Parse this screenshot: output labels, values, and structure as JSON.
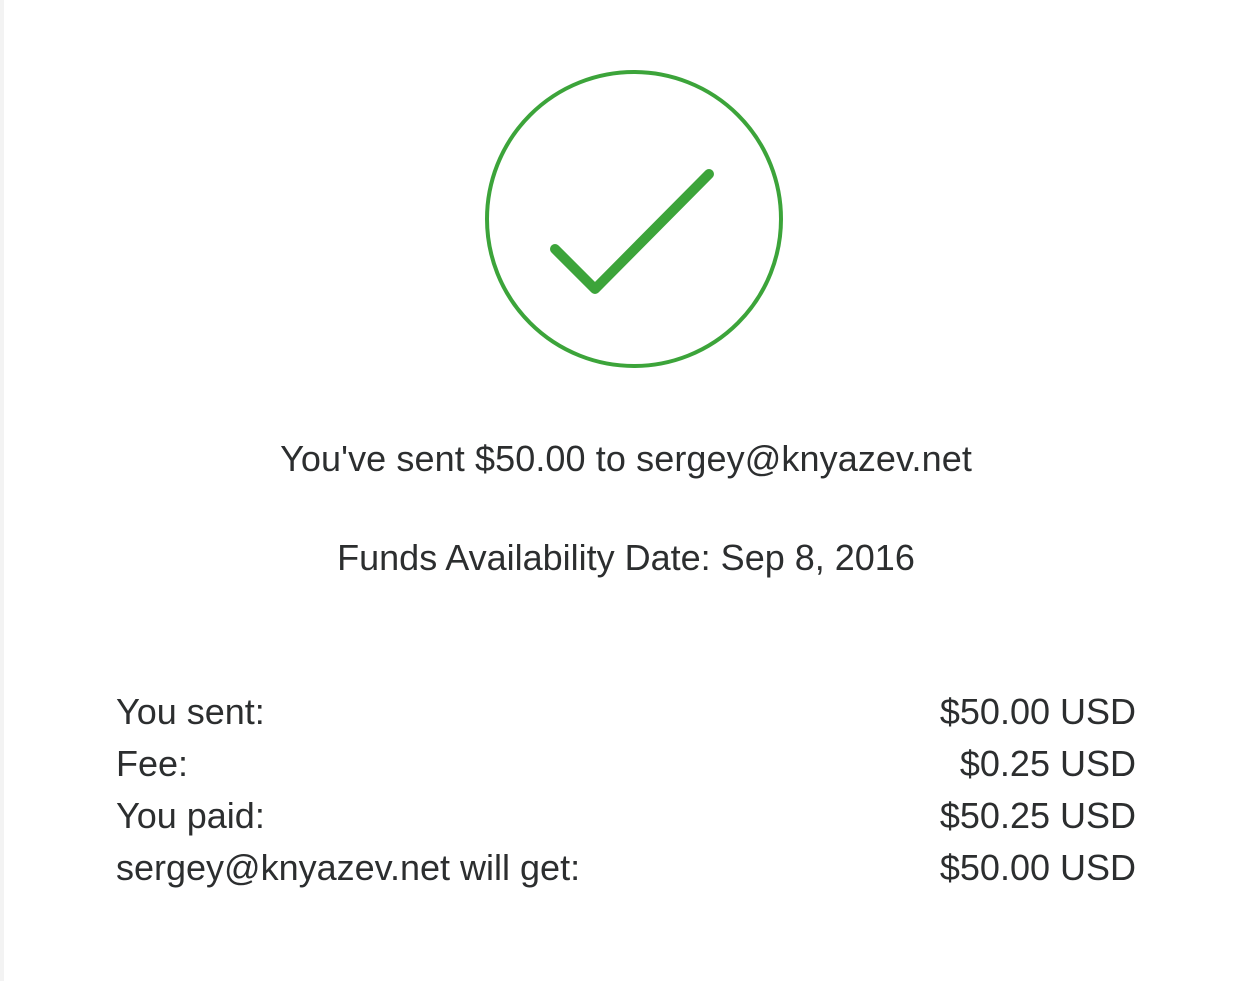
{
  "status": {
    "icon": "checkmark-circle-icon",
    "color": "#3ca43a"
  },
  "confirmation": {
    "message": "You've sent $50.00 to sergey@knyazev.net",
    "availability": "Funds Availability Date: Sep 8, 2016"
  },
  "summary": {
    "rows": [
      {
        "label": "You sent:",
        "value": "$50.00 USD"
      },
      {
        "label": "Fee:",
        "value": "$0.25 USD"
      },
      {
        "label": "You paid:",
        "value": "$50.25 USD"
      },
      {
        "label": "sergey@knyazev.net will get:",
        "value": "$50.00 USD"
      }
    ]
  }
}
